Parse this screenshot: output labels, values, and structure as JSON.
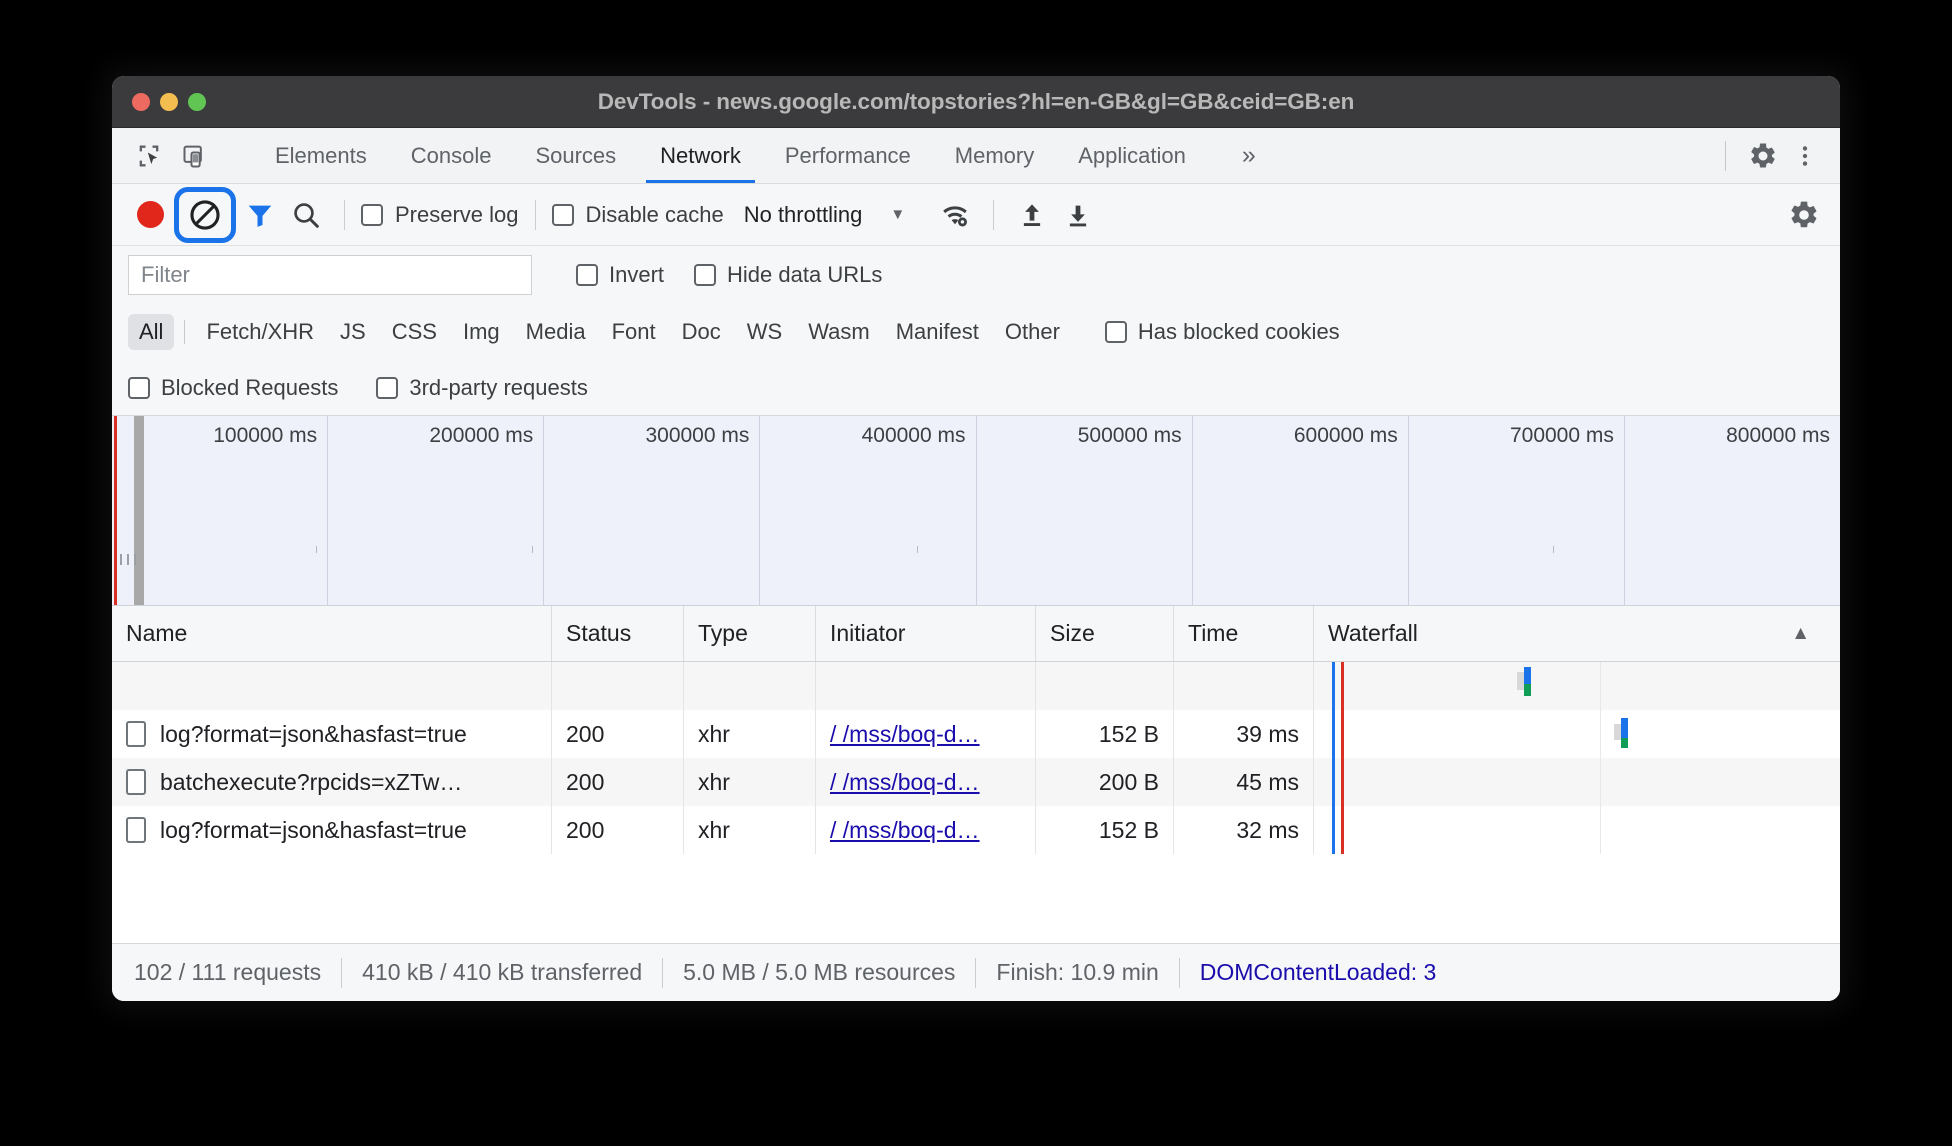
{
  "window": {
    "title": "DevTools - news.google.com/topstories?hl=en-GB&gl=GB&ceid=GB:en"
  },
  "tabstrip": {
    "tabs": [
      {
        "label": "Elements",
        "active": false
      },
      {
        "label": "Console",
        "active": false
      },
      {
        "label": "Sources",
        "active": false
      },
      {
        "label": "Network",
        "active": true
      },
      {
        "label": "Performance",
        "active": false
      },
      {
        "label": "Memory",
        "active": false
      },
      {
        "label": "Application",
        "active": false
      }
    ],
    "more_label": "»",
    "icons": [
      "inspect-icon",
      "device-toolbar-icon",
      "settings-gear-icon",
      "more-vertical-icon"
    ]
  },
  "toolbar": {
    "record_title": "record-button",
    "clear_title": "clear-button",
    "filter_title": "filter-button",
    "search_title": "search-button",
    "preserve_log": "Preserve log",
    "disable_cache": "Disable cache",
    "throttling": "No throttling",
    "caret": "▼",
    "import_title": "import-har-button",
    "export_title": "export-har-button",
    "settings_title": "network-settings-button"
  },
  "filter_bar": {
    "placeholder": "Filter",
    "value": "",
    "invert": "Invert",
    "hide_data_urls": "Hide data URLs"
  },
  "type_filters": {
    "all": "All",
    "types": [
      "Fetch/XHR",
      "JS",
      "CSS",
      "Img",
      "Media",
      "Font",
      "Doc",
      "WS",
      "Wasm",
      "Manifest",
      "Other"
    ],
    "has_blocked_cookies": "Has blocked cookies"
  },
  "extra_filters": {
    "blocked_requests": "Blocked Requests",
    "third_party_requests": "3rd-party requests"
  },
  "overview": {
    "ticks": [
      "100000 ms",
      "200000 ms",
      "300000 ms",
      "400000 ms",
      "500000 ms",
      "600000 ms",
      "700000 ms",
      "800000 ms"
    ]
  },
  "table": {
    "columns": [
      "Name",
      "Status",
      "Type",
      "Initiator",
      "Size",
      "Time",
      "Waterfall"
    ],
    "sort_indicator": "▲",
    "rows": [
      {
        "name": "log?format=json&hasfast=true",
        "status": "200",
        "type": "xhr",
        "initiator": "/  /mss/boq-d…",
        "size": "152 B",
        "time": "39 ms"
      },
      {
        "name": "batchexecute?rpcids=xZTw…",
        "status": "200",
        "type": "xhr",
        "initiator": "/  /mss/boq-d…",
        "size": "200 B",
        "time": "45 ms"
      },
      {
        "name": "log?format=json&hasfast=true",
        "status": "200",
        "type": "xhr",
        "initiator": "/  /mss/boq-d…",
        "size": "152 B",
        "time": "32 ms"
      }
    ]
  },
  "statusbar": {
    "requests": "102 / 111 requests",
    "transferred": "410 kB / 410 kB transferred",
    "resources": "5.0 MB / 5.0 MB resources",
    "finish": "Finish: 10.9 min",
    "dom_content_loaded": "DOMContentLoaded: 3"
  },
  "colors": {
    "accent": "#1a73e8",
    "record_red": "#e1261c",
    "link": "#1a0dab",
    "titlebar": "#3b3b3d",
    "panel_bg": "#f6f7f8",
    "overview_bg": "#eef1f9"
  }
}
